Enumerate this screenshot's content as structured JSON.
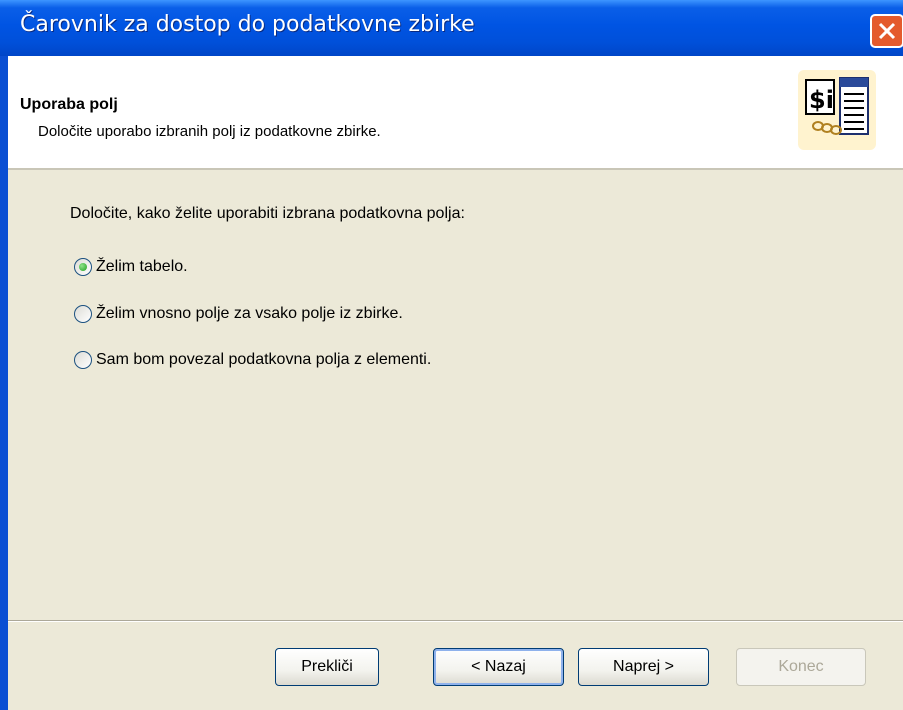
{
  "window": {
    "title": "Čarovnik za dostop do podatkovne zbirke"
  },
  "header": {
    "title": "Uporaba polj",
    "subtitle": "Določite uporabo izbranih polj iz podatkovne zbirke."
  },
  "main": {
    "prompt": "Določite, kako želite uporabiti izbrana podatkovna polja:",
    "options": [
      {
        "label": "Želim tabelo.",
        "selected": true
      },
      {
        "label": "Želim vnosno polje za vsako polje iz zbirke.",
        "selected": false
      },
      {
        "label": "Sam bom povezal podatkovna polja z elementi.",
        "selected": false
      }
    ]
  },
  "buttons": {
    "cancel": "Prekliči",
    "back": "< Nazaj",
    "next": "Naprej >",
    "finish": "Konec"
  }
}
